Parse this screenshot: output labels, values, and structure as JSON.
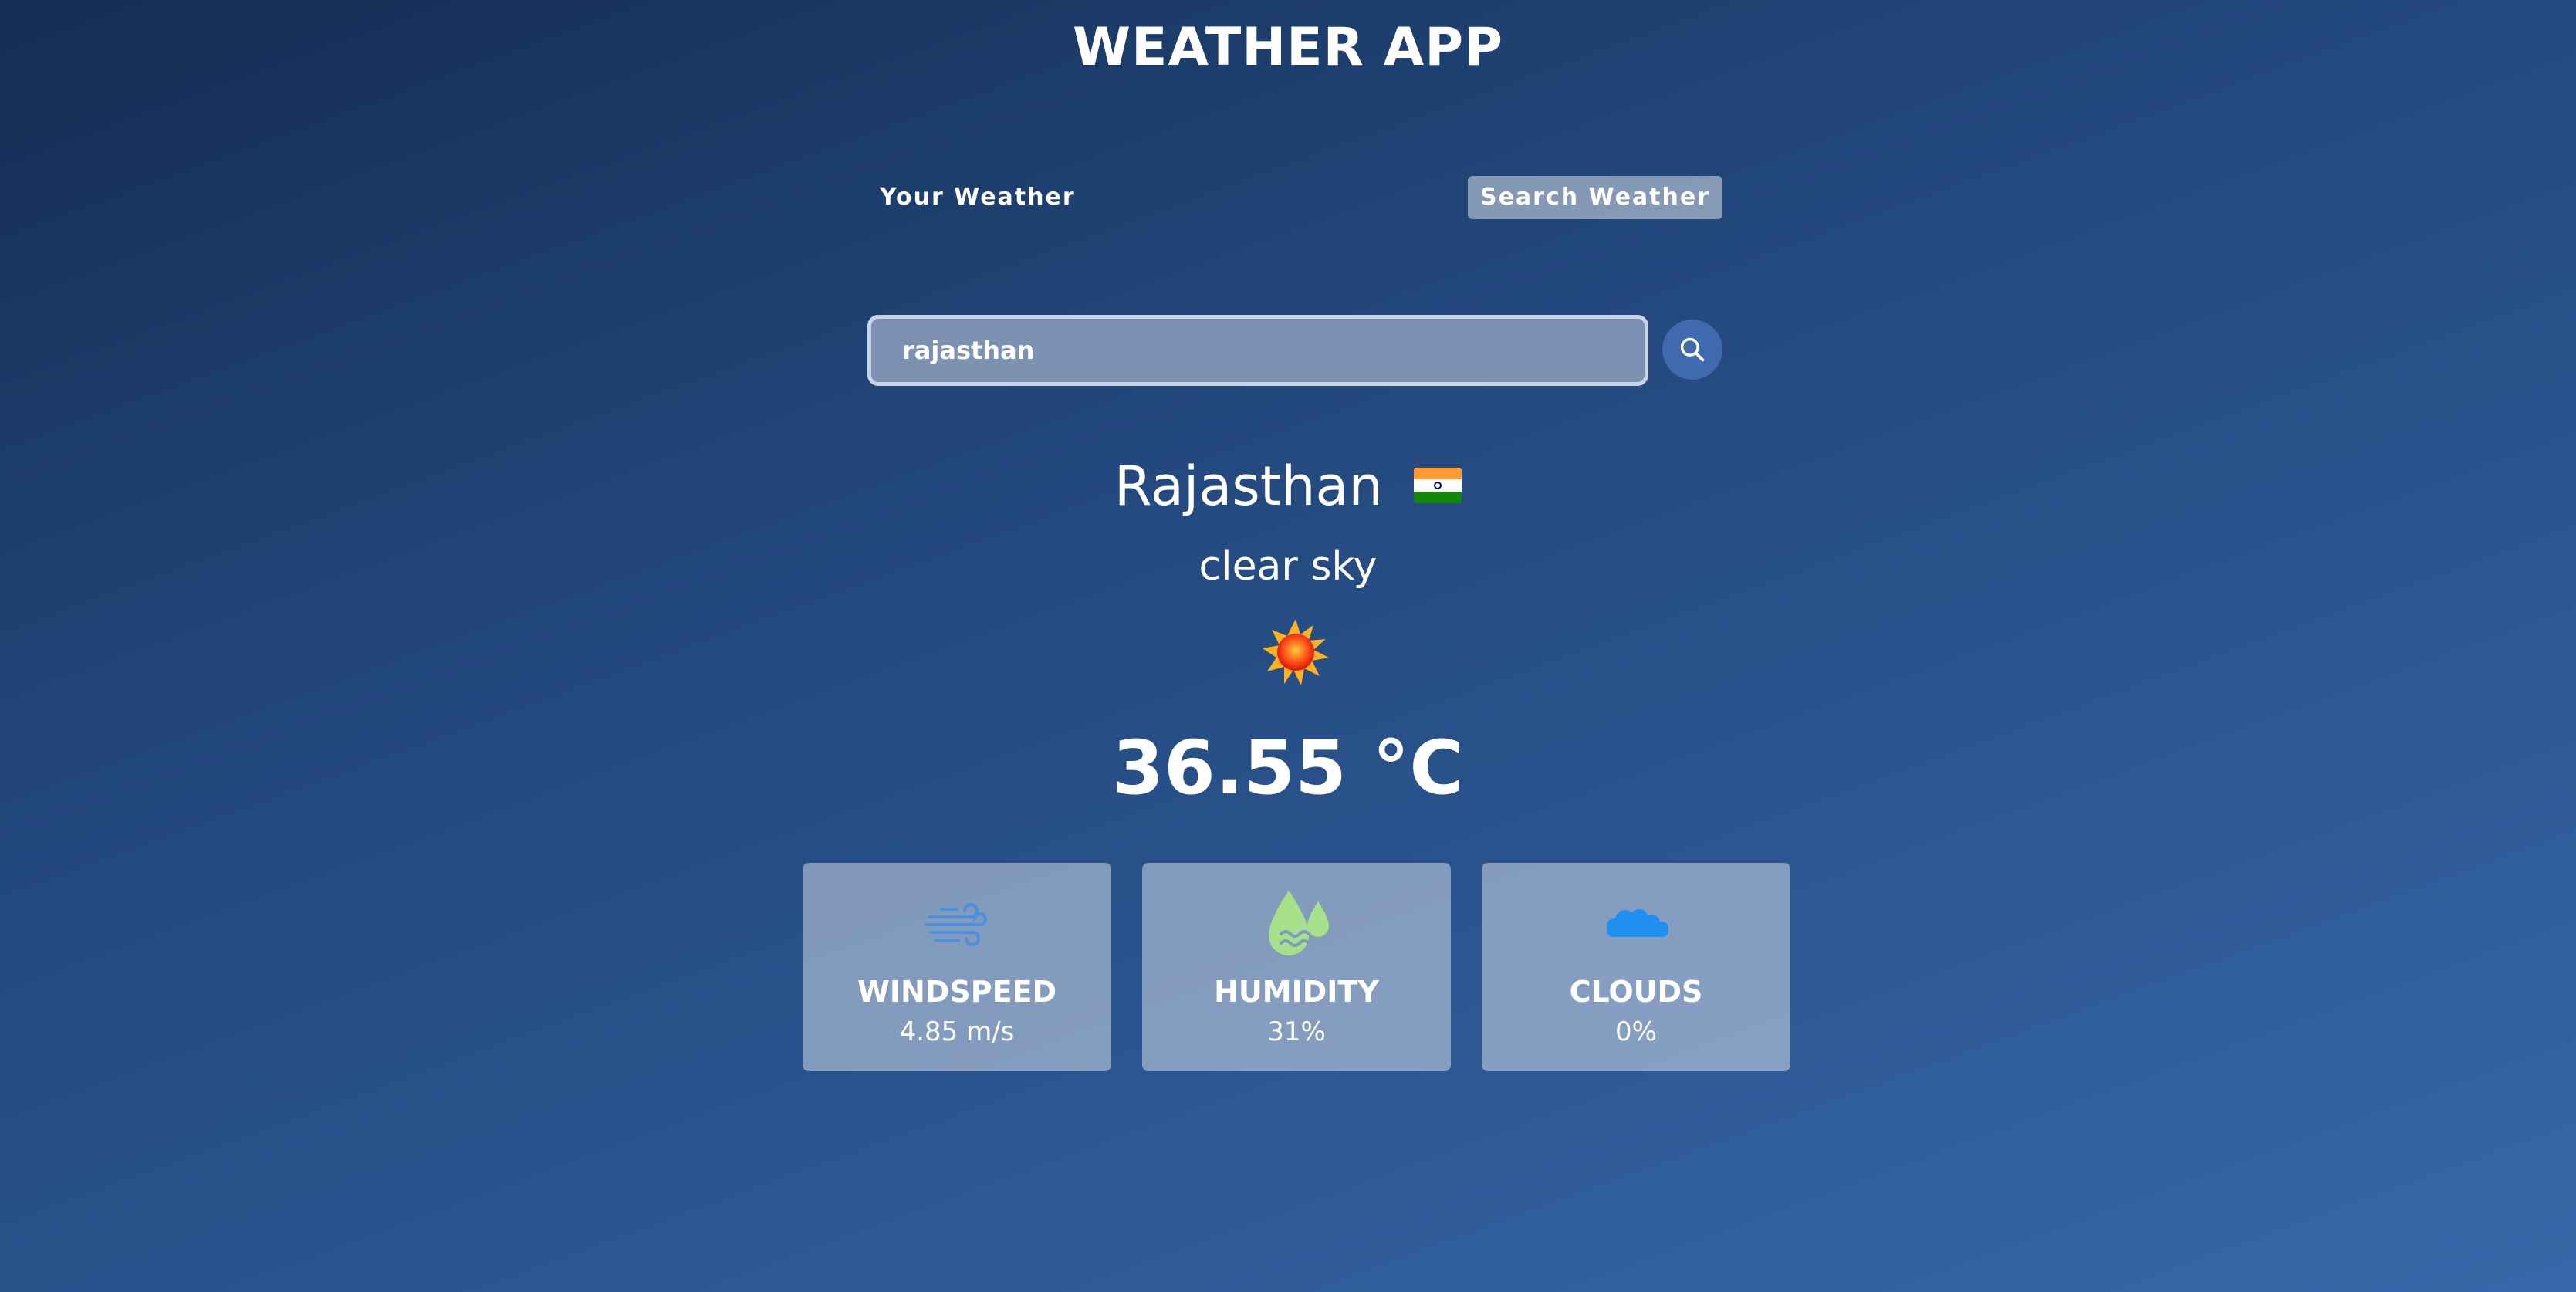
{
  "app": {
    "title": "WEATHER APP"
  },
  "tabs": {
    "your_weather": "Your Weather",
    "search_weather": "Search Weather",
    "active": "Search Weather"
  },
  "search": {
    "value": "rajasthan",
    "button_icon": "search-icon"
  },
  "weather": {
    "city": "Rajasthan",
    "country_flag_icon": "india-flag-icon",
    "description": "clear sky",
    "condition_icon": "sun-icon",
    "temperature": "36.55 °C"
  },
  "stats": [
    {
      "label": "WINDSPEED",
      "value": "4.85 m/s",
      "icon": "wind-icon",
      "icon_color": "#4a8fe0"
    },
    {
      "label": "HUMIDITY",
      "value": "31%",
      "icon": "humidity-drops-icon",
      "icon_color": "#a6e08a"
    },
    {
      "label": "CLOUDS",
      "value": "0%",
      "icon": "cloud-icon",
      "icon_color": "#1f8ff0"
    }
  ],
  "colors": {
    "background_top": "#142d52",
    "background_bottom": "#3769aa",
    "search_button": "#3f6aae",
    "input_background": "#7d91b2"
  }
}
